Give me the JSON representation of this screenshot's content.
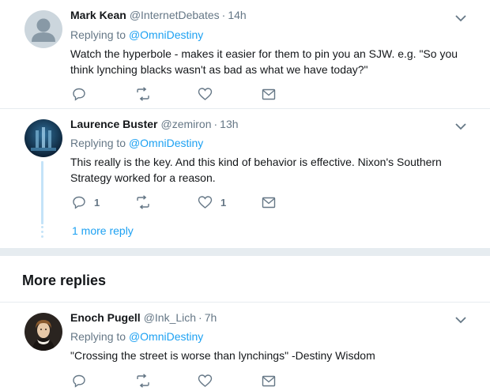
{
  "tweets": [
    {
      "name": "Mark Kean",
      "handle": "@InternetDebates",
      "dot": "·",
      "time": "14h",
      "replying_prefix": "Replying to",
      "replying_to": "@OmniDestiny",
      "text": "Watch the hyperbole - makes it easier for them to pin you an SJW. e.g. \"So you think lynching blacks wasn't as bad as what we have today?\"",
      "reply_count": "",
      "like_count": ""
    },
    {
      "name": "Laurence Buster",
      "handle": "@zemiron",
      "dot": "·",
      "time": "13h",
      "replying_prefix": "Replying to",
      "replying_to": "@OmniDestiny",
      "text": "This really is the key. And this kind of behavior is effective. Nixon's Southern Strategy worked for a reason.",
      "reply_count": "1",
      "like_count": "1",
      "more_replies": "1 more reply"
    },
    {
      "name": "Enoch Pugell",
      "handle": "@Ink_Lich",
      "dot": "·",
      "time": "7h",
      "replying_prefix": "Replying to",
      "replying_to": "@OmniDestiny",
      "text": "\"Crossing the street is worse than lynchings\" -Destiny Wisdom",
      "reply_count": "",
      "like_count": ""
    }
  ],
  "section": {
    "more_replies_title": "More replies"
  },
  "icons": {
    "reply": "reply-icon",
    "retweet": "retweet-icon",
    "like": "heart-icon",
    "dm": "envelope-icon",
    "caret": "chevron-down-icon"
  },
  "colors": {
    "accent": "#1da1f2",
    "muted": "#657786",
    "divider": "#e6ecf0",
    "thread": "#c4e3f8"
  }
}
